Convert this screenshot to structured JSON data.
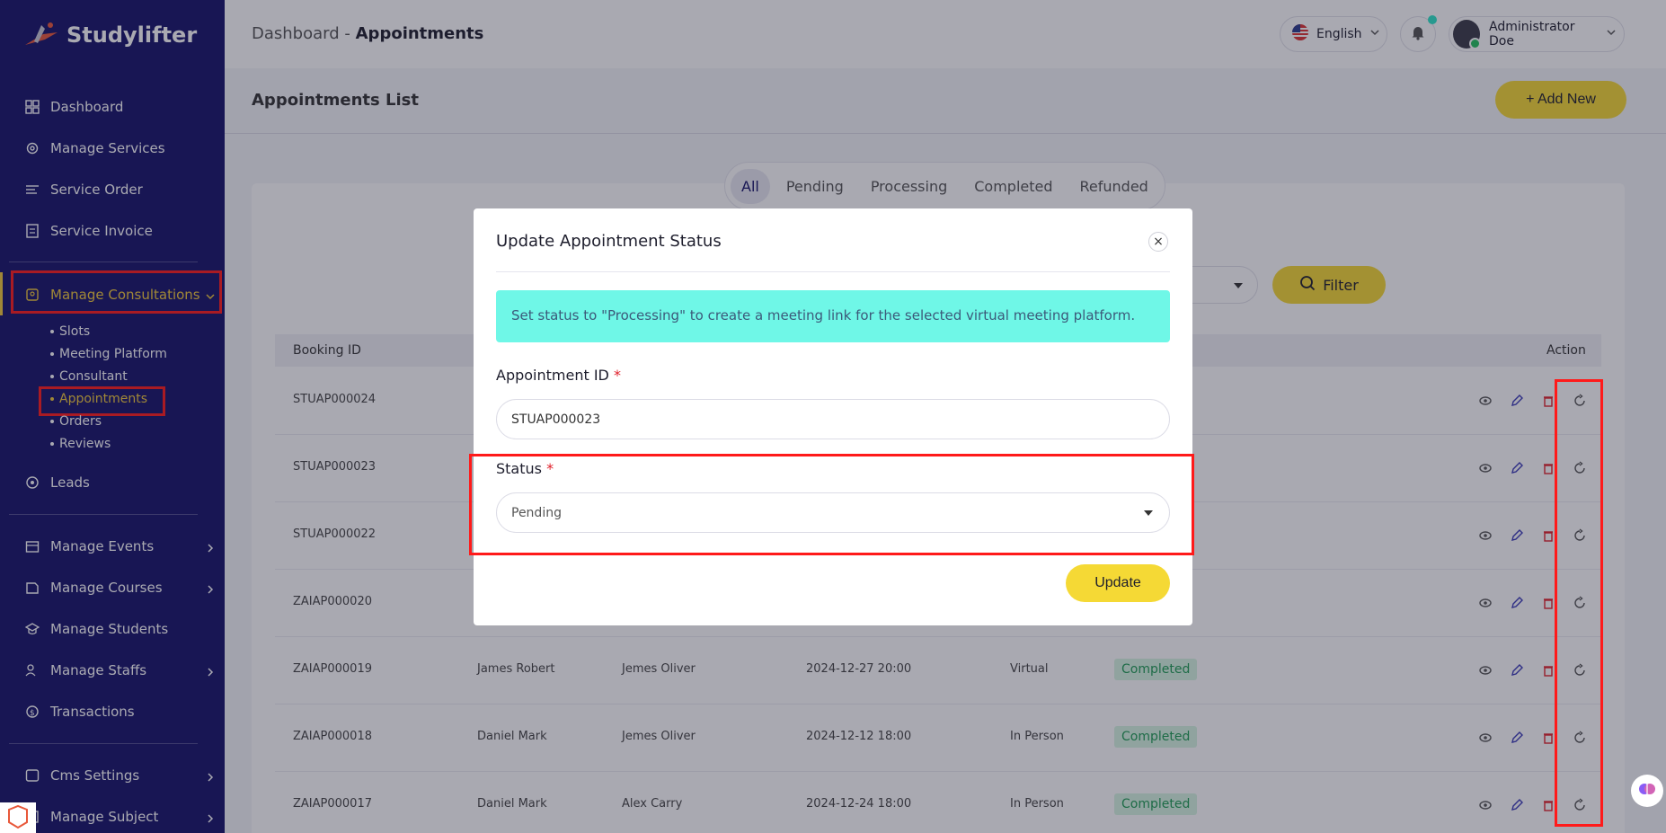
{
  "app": {
    "name": "Studylifter"
  },
  "sidebar": {
    "items": [
      {
        "label": "Dashboard",
        "icon": "dashboard-icon"
      },
      {
        "label": "Manage Services",
        "icon": "services-icon"
      },
      {
        "label": "Service Order",
        "icon": "order-icon"
      },
      {
        "label": "Service Invoice",
        "icon": "invoice-icon"
      },
      {
        "label": "Manage Consultations",
        "icon": "consultation-icon"
      },
      {
        "label": "Leads",
        "icon": "leads-icon"
      },
      {
        "label": "Manage Events",
        "icon": "events-icon"
      },
      {
        "label": "Manage Courses",
        "icon": "courses-icon"
      },
      {
        "label": "Manage Students",
        "icon": "students-icon"
      },
      {
        "label": "Manage Staffs",
        "icon": "staffs-icon"
      },
      {
        "label": "Transactions",
        "icon": "transactions-icon"
      },
      {
        "label": "Cms Settings",
        "icon": "cms-icon"
      },
      {
        "label": "Manage Subject",
        "icon": "subject-icon"
      }
    ],
    "sub_items": [
      "Slots",
      "Meeting Platform",
      "Consultant",
      "Appointments",
      "Orders",
      "Reviews"
    ]
  },
  "header": {
    "breadcrumb_root": "Dashboard",
    "breadcrumb_separator": "-",
    "breadcrumb_current": "Appointments",
    "language": "English",
    "user_name": "Administrator Doe"
  },
  "page": {
    "title": "Appointments List",
    "add_button": "+ Add New",
    "filter_button": "Filter",
    "tabs": [
      "All",
      "Pending",
      "Processing",
      "Completed",
      "Refunded"
    ],
    "columns": {
      "booking_id": "Booking ID",
      "action": "Action"
    },
    "rows": [
      {
        "id": "STUAP000024",
        "student": "",
        "consultant": "",
        "date": "",
        "type": "",
        "status": ""
      },
      {
        "id": "STUAP000023",
        "student": "",
        "consultant": "",
        "date": "",
        "type": "",
        "status": ""
      },
      {
        "id": "STUAP000022",
        "student": "",
        "consultant": "",
        "date": "",
        "type": "",
        "status": ""
      },
      {
        "id": "ZAIAP000020",
        "student": "",
        "consultant": "",
        "date": "",
        "type": "",
        "status": ""
      },
      {
        "id": "ZAIAP000019",
        "student": "James Robert",
        "consultant": "Jemes Oliver",
        "date": "2024-12-27 20:00",
        "type": "Virtual",
        "status": "Completed"
      },
      {
        "id": "ZAIAP000018",
        "student": "Daniel Mark",
        "consultant": "Jemes Oliver",
        "date": "2024-12-12 18:00",
        "type": "In Person",
        "status": "Completed"
      },
      {
        "id": "ZAIAP000017",
        "student": "Daniel Mark",
        "consultant": "Alex Carry",
        "date": "2024-12-24 18:00",
        "type": "In Person",
        "status": "Completed"
      }
    ]
  },
  "modal": {
    "title": "Update Appointment Status",
    "close": "×",
    "notice": "Set status to \"Processing\" to create a meeting link for the selected virtual meeting platform.",
    "appointment_id_label": "Appointment ID",
    "appointment_id_value": "STUAP000023",
    "status_label": "Status",
    "status_value": "Pending",
    "required_mark": "*",
    "update_button": "Update"
  },
  "colors": {
    "sidebar_bg": "#15126a",
    "accent": "#f5d935",
    "notice_bg": "#6ff7e7",
    "highlight": "#ff1a1a"
  }
}
